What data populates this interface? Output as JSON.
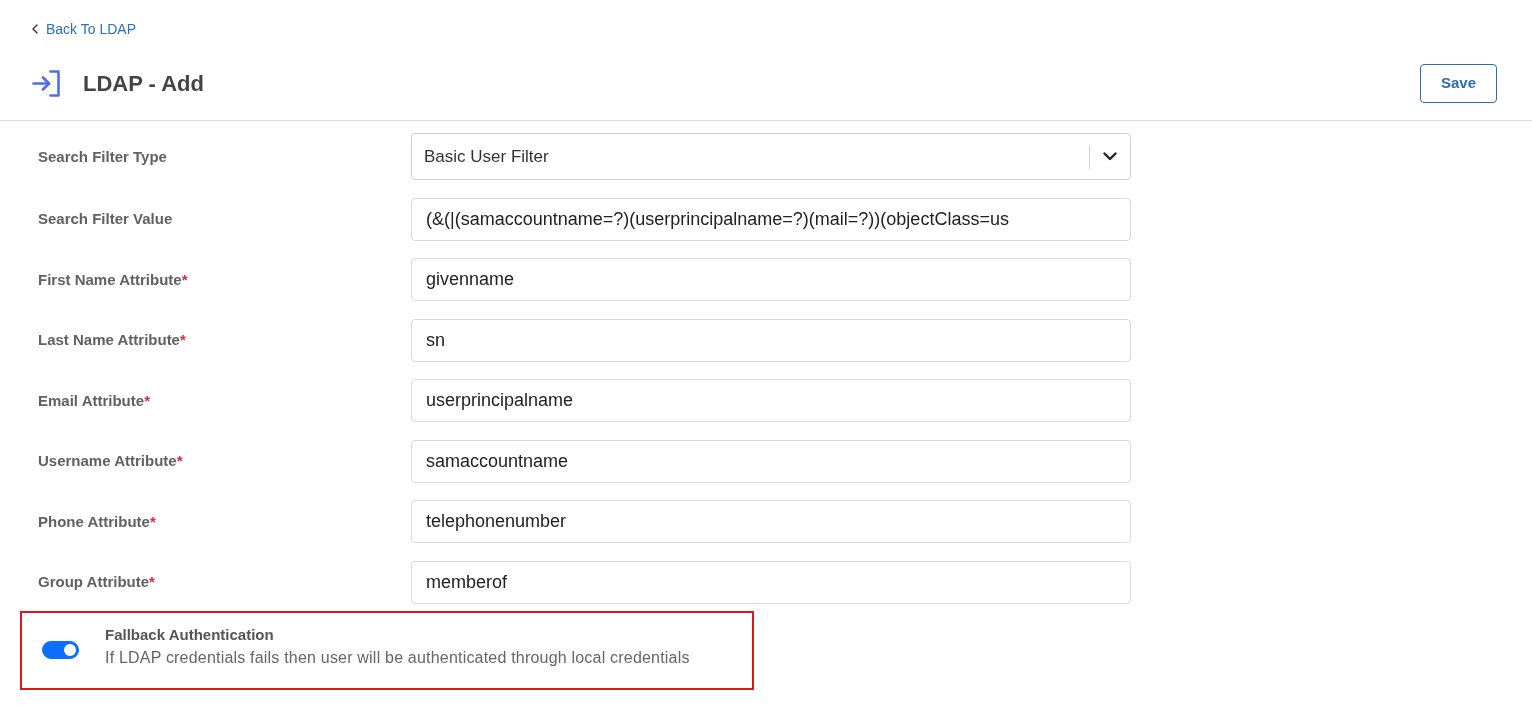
{
  "back_link": {
    "label": "Back To LDAP"
  },
  "header": {
    "title": "LDAP - Add",
    "save_button": "Save"
  },
  "form": {
    "required_mark": "*",
    "fields": [
      {
        "kind": "select",
        "label": "Search Filter Type",
        "required": false,
        "value": "Basic User Filter"
      },
      {
        "kind": "text",
        "label": "Search Filter Value",
        "required": false,
        "value": "(&(|(samaccountname=?)(userprincipalname=?)(mail=?))(objectClass=us"
      },
      {
        "kind": "text",
        "label": "First Name Attribute",
        "required": true,
        "value": "givenname"
      },
      {
        "kind": "text",
        "label": "Last Name Attribute",
        "required": true,
        "value": "sn"
      },
      {
        "kind": "text",
        "label": "Email Attribute",
        "required": true,
        "value": "userprincipalname"
      },
      {
        "kind": "text",
        "label": "Username Attribute",
        "required": true,
        "value": "samaccountname"
      },
      {
        "kind": "text",
        "label": "Phone Attribute",
        "required": true,
        "value": "telephonenumber"
      },
      {
        "kind": "text",
        "label": "Group Attribute",
        "required": true,
        "value": "memberof"
      }
    ]
  },
  "fallback": {
    "title": "Fallback Authentication",
    "description": "If LDAP credentials fails then user will be authenticated through local credentials",
    "on": true,
    "highlighted": true
  }
}
